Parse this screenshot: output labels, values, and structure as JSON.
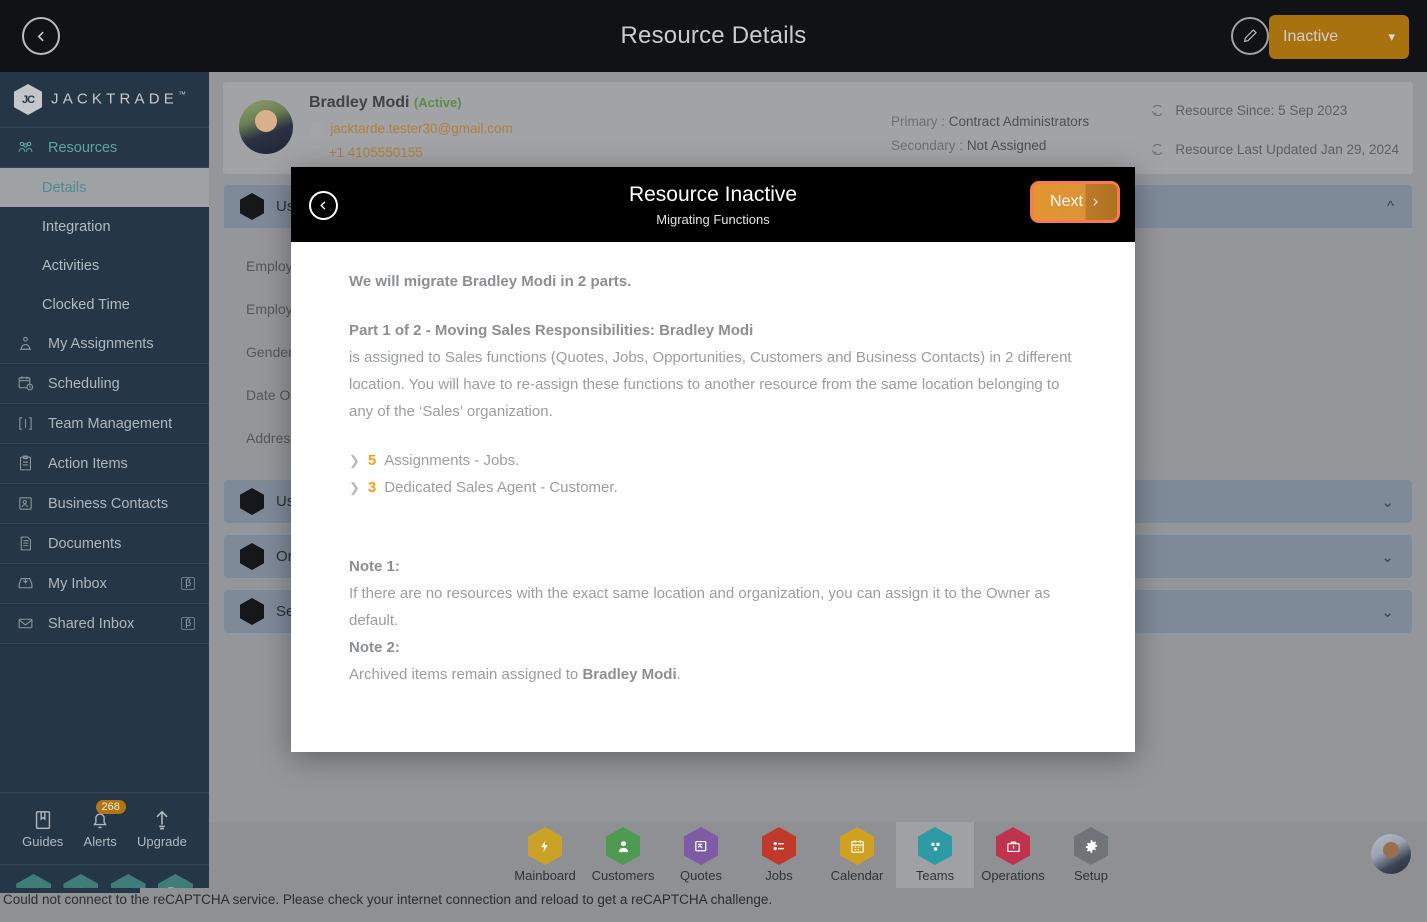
{
  "topbar": {
    "title": "Resource Details",
    "back_icon": "chevron-left-circle-icon",
    "edit_icon": "pencil-circle-icon",
    "status_value": "Inactive",
    "status_chevron": "chevron-down-icon",
    "status_color": "#a8720f"
  },
  "sidebar": {
    "brand": "JACKTRADE",
    "brand_mark": "JC",
    "brand_tm": "™",
    "items": [
      {
        "label": "Resources",
        "icon": "resources-icon",
        "type": "group"
      },
      {
        "label": "Details",
        "icon": "",
        "type": "sub",
        "active": true
      },
      {
        "label": "Integration",
        "icon": "",
        "type": "sub",
        "active": false
      },
      {
        "label": "Activities",
        "icon": "",
        "type": "sub",
        "active": false
      },
      {
        "label": "Clocked Time",
        "icon": "",
        "type": "sub",
        "active": false
      },
      {
        "label": "My Assignments",
        "icon": "assignments-icon",
        "type": "item"
      },
      {
        "label": "Scheduling",
        "icon": "calendar-clock-icon",
        "type": "item"
      },
      {
        "label": "Team Management",
        "icon": "team-icon",
        "type": "item"
      },
      {
        "label": "Action Items",
        "icon": "clipboard-icon",
        "type": "item"
      },
      {
        "label": "Business Contacts",
        "icon": "contact-card-icon",
        "type": "item"
      },
      {
        "label": "Documents",
        "icon": "document-icon",
        "type": "item"
      },
      {
        "label": "My Inbox",
        "icon": "inbox-down-icon",
        "type": "item",
        "badge": "β"
      },
      {
        "label": "Shared Inbox",
        "icon": "envelope-icon",
        "type": "item",
        "badge": "β"
      }
    ],
    "tools": [
      {
        "label": "Guides",
        "icon": "book-icon"
      },
      {
        "label": "Alerts",
        "icon": "bell-icon",
        "badge": "268"
      },
      {
        "label": "Upgrade",
        "icon": "arrow-up-icon"
      }
    ],
    "quick_hexes": [
      {
        "icon": "person-icon"
      },
      {
        "icon": "dollar-icon"
      },
      {
        "icon": "money-transfer-icon"
      },
      {
        "icon": "workflow-icon"
      }
    ]
  },
  "resource": {
    "name": "Bradley Modi",
    "status": "(Active)",
    "email": "jacktarde.tester30@gmail.com",
    "email_icon": "at-icon",
    "phone": "+1 4105550155",
    "phone_icon": "phone-icon",
    "primary_label": "Primary :",
    "primary_value": "Contract Administrators",
    "secondary_label": "Secondary :",
    "secondary_value": "Not Assigned",
    "since_icon": "refresh-icon",
    "since": "Resource Since: 5 Sep 2023",
    "updated_icon": "refresh-icon",
    "updated": "Resource Last Updated Jan 29, 2024"
  },
  "panels": [
    {
      "title": "User Profile",
      "chevron": "chevron-up-icon",
      "expanded": true,
      "fields": [
        "Employee ID",
        "Employee Type",
        "Gender",
        "Date Of Birth",
        "Address"
      ]
    },
    {
      "title": "User Access",
      "chevron": "chevron-down-icon",
      "expanded": false
    },
    {
      "title": "Organization",
      "chevron": "chevron-down-icon",
      "expanded": false
    },
    {
      "title": "Settings",
      "chevron": "chevron-down-icon",
      "expanded": false
    }
  ],
  "modal": {
    "back_icon": "chevron-left-circle-icon",
    "title": "Resource Inactive",
    "subtitle": "Migrating Functions",
    "next_label": "Next",
    "next_icon": "chevron-right-icon",
    "intro": "We will migrate Bradley Modi in 2 parts.",
    "part_heading": "Part 1 of 2 - Moving Sales Responsibilities: Bradley Modi",
    "part_body": "is assigned to Sales functions (Quotes, Jobs, Opportunities, Customers and Business Contacts) in 2 different location. You will have to re-assign these functions to another resource from the same location belonging to any of the ‘Sales’ organization.",
    "links": [
      {
        "chevron": "chevron-right-icon",
        "count": "5",
        "text": "Assignments - Jobs."
      },
      {
        "chevron": "chevron-right-icon",
        "count": "3",
        "text": "Dedicated Sales Agent - Customer."
      }
    ],
    "note1_head": "Note 1:",
    "note1_body": "If there are no resources with the exact same location and organization, you can assign it to the Owner as default.",
    "note2_head": "Note 2:",
    "note2_body_pre": "Archived items remain assigned to ",
    "note2_body_strong": "Bradley Modi",
    "note2_body_post": ".",
    "accent_orange": "#f0a020",
    "next_border": "#f57b52"
  },
  "bottom_nav": [
    {
      "label": "Mainboard",
      "icon": "mainboard-icon",
      "color": "#c9a227",
      "active": false
    },
    {
      "label": "Customers",
      "icon": "customers-icon",
      "color": "#4e9a51",
      "active": false
    },
    {
      "label": "Quotes",
      "icon": "quotes-icon",
      "color": "#7e5ba6",
      "active": false
    },
    {
      "label": "Jobs",
      "icon": "jobs-icon",
      "color": "#c0392b",
      "active": false
    },
    {
      "label": "Calendar",
      "icon": "calendar-icon",
      "color": "#d0a021",
      "active": false
    },
    {
      "label": "Teams",
      "icon": "teams-icon",
      "color": "#2e9aa4",
      "active": true
    },
    {
      "label": "Operations",
      "icon": "operations-icon",
      "color": "#c0334f",
      "active": false
    },
    {
      "label": "Setup",
      "icon": "setup-icon",
      "color": "#6f7478",
      "active": false
    }
  ],
  "statusbar": {
    "message": "Could not connect to the reCAPTCHA service. Please check your internet connection and reload to get a reCAPTCHA challenge."
  }
}
